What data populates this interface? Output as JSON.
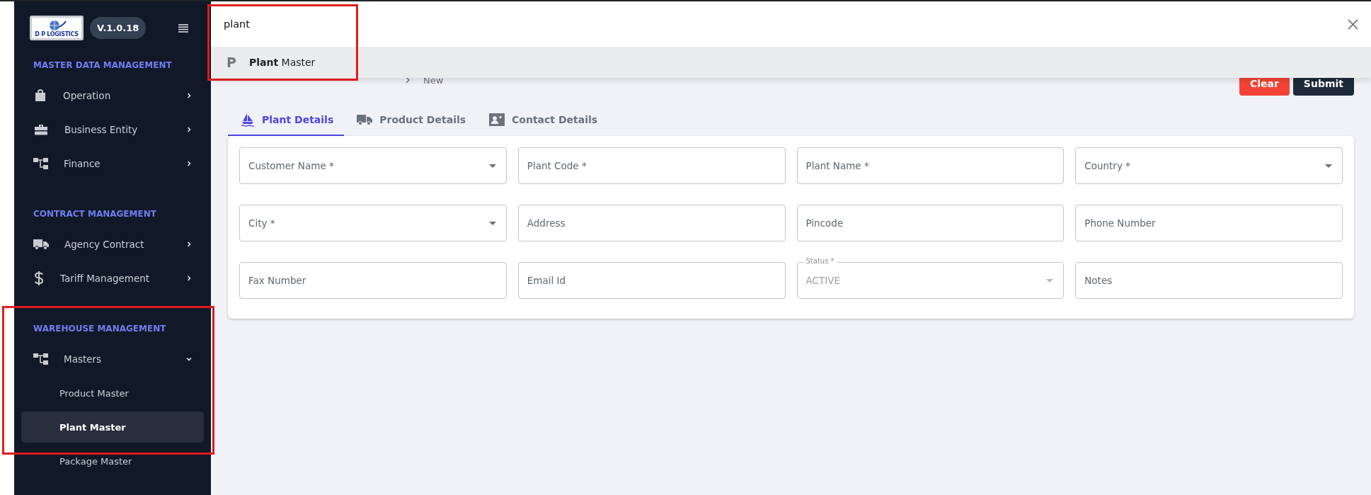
{
  "sidebar": {
    "logo_text": "D P LOGISTICS",
    "version": "V.1.0.18",
    "sections": [
      {
        "heading": "MASTER DATA MANAGEMENT",
        "items": [
          {
            "label": "Operation",
            "expanded": false
          },
          {
            "label": "Business Entity",
            "expanded": false
          },
          {
            "label": "Finance",
            "expanded": false
          }
        ]
      },
      {
        "heading": "CONTRACT MANAGEMENT",
        "items": [
          {
            "label": "Agency Contract",
            "expanded": false
          },
          {
            "label": "Tariff Management",
            "expanded": false
          }
        ]
      },
      {
        "heading": "WAREHOUSE MANAGEMENT",
        "items": [
          {
            "label": "Masters",
            "expanded": true,
            "children": [
              {
                "label": "Product Master",
                "selected": false
              },
              {
                "label": "Plant Master",
                "selected": true
              },
              {
                "label": "Package Master",
                "selected": false
              }
            ]
          }
        ]
      }
    ]
  },
  "search": {
    "value": "plant",
    "results": [
      {
        "letter": "P",
        "text": "**Plant** Master"
      }
    ]
  },
  "page": {
    "breadcrumb": "New",
    "buttons": [
      {
        "label": "Clear",
        "kind": "danger"
      },
      {
        "label": "Submit",
        "kind": "primary"
      }
    ]
  },
  "tabs": [
    {
      "label": "Plant Details",
      "selected": true
    },
    {
      "label": "Product Details",
      "selected": false
    },
    {
      "label": "Contact Details",
      "selected": false
    }
  ],
  "fields": [
    {
      "kind": "select",
      "placeholder": "Customer Name *"
    },
    {
      "kind": "text",
      "placeholder": "Plant Code *"
    },
    {
      "kind": "text",
      "placeholder": "Plant Name *"
    },
    {
      "kind": "select",
      "placeholder": "Country *"
    },
    {
      "kind": "select",
      "placeholder": "City *"
    },
    {
      "kind": "text",
      "placeholder": "Address"
    },
    {
      "kind": "text",
      "placeholder": "Pincode"
    },
    {
      "kind": "text",
      "placeholder": "Phone Number"
    },
    {
      "kind": "text",
      "placeholder": "Fax Number"
    },
    {
      "kind": "text",
      "placeholder": "Email Id"
    },
    {
      "kind": "select",
      "label": "Status *",
      "value": "ACTIVE",
      "disabled": true
    },
    {
      "kind": "text",
      "placeholder": "Notes"
    }
  ]
}
